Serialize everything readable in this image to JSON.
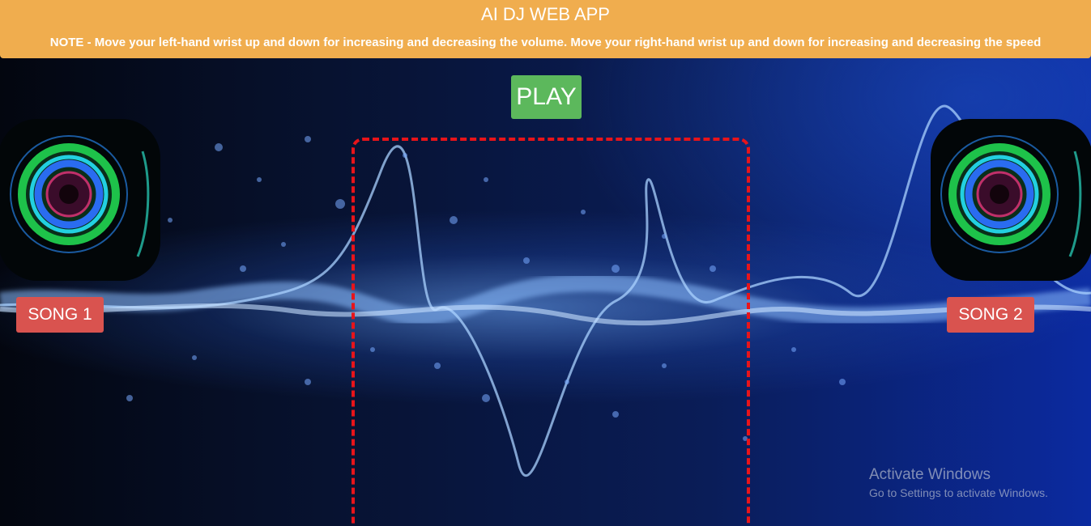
{
  "header": {
    "title": "AI DJ WEB APP",
    "note": "NOTE - Move your left-hand wrist up and down for increasing and decreasing the volume. Move your right-hand wrist up and down for increasing and decreasing the speed"
  },
  "controls": {
    "play_label": "PLAY",
    "song1_label": "SONG 1",
    "song2_label": "SONG 2"
  },
  "watermark": {
    "title": "Activate Windows",
    "subtitle": "Go to Settings to activate Windows."
  },
  "colors": {
    "header_bg": "#f0ad4e",
    "play_button": "#5cb85c",
    "song_button": "#d9534f",
    "canvas_border": "#e8141a"
  },
  "icons": {
    "speaker": "speaker-icon"
  }
}
